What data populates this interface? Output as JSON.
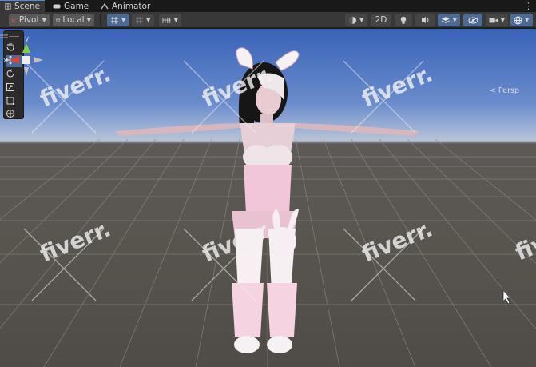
{
  "tabs": [
    {
      "label": "Scene",
      "icon": "grid-icon"
    },
    {
      "label": "Game",
      "icon": "gamepad-icon"
    },
    {
      "label": "Animator",
      "icon": "animator-icon"
    }
  ],
  "toolbar": {
    "pivot_label": "Pivot",
    "local_label": "Local",
    "mode_2d_label": "2D"
  },
  "tools": [
    "hand-tool",
    "move-tool",
    "rotate-tool",
    "scale-tool",
    "rect-tool",
    "transform-tool"
  ],
  "gizmo": {
    "y_axis": "y",
    "x_axis": "x",
    "projection_label": "< Persp"
  },
  "watermark": "fiverr.",
  "colors": {
    "accent": "#4c6a93",
    "x_axis": "#e2413b",
    "y_axis": "#7fcf3f",
    "z_axis": "#3a78e0"
  }
}
